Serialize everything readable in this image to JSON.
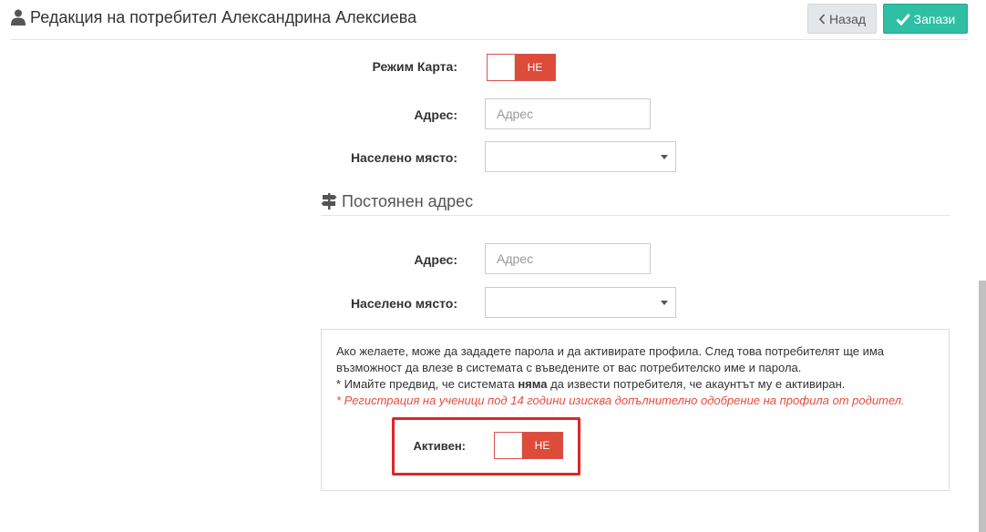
{
  "header": {
    "title": "Редакция на потребител Александрина Алексиева",
    "back_label": "Назад",
    "save_label": "Запази"
  },
  "map_mode": {
    "label": "Режим Карта:",
    "state": "НЕ"
  },
  "address": {
    "label": "Адрес:",
    "placeholder": "Адрес",
    "value": ""
  },
  "settlement": {
    "label": "Населено място:",
    "value": ""
  },
  "permanent_address": {
    "title": "Постоянен адрес",
    "address": {
      "label": "Адрес:",
      "placeholder": "Адрес",
      "value": ""
    },
    "settlement": {
      "label": "Населено място:",
      "value": ""
    }
  },
  "activation": {
    "text_line1": "Ако желаете, може да зададете парола и да активирате профила. След това потребителят ще има",
    "text_line2": "възможност да влезе в системата с въведените от вас потребителско име и парола.",
    "note_prefix": "* Имайте предвид, че системата ",
    "note_bold": "няма",
    "note_suffix": " да извести потребителя, че акаунтът му е активиран.",
    "warning": "* Регистрация на ученици под 14 години изисква допълнително одобрение на профила от родител.",
    "active_label": "Активен:",
    "active_state": "НЕ"
  },
  "colors": {
    "accent_save": "#2ebfa5",
    "toggle_off": "#dd4b39",
    "highlight": "#e02424",
    "warning_text": "#e74c3c"
  },
  "icons": {
    "title": "user-icon",
    "back": "chevron-left-icon",
    "save": "check-icon",
    "section": "signpost-icon",
    "select": "caret-down-icon"
  }
}
